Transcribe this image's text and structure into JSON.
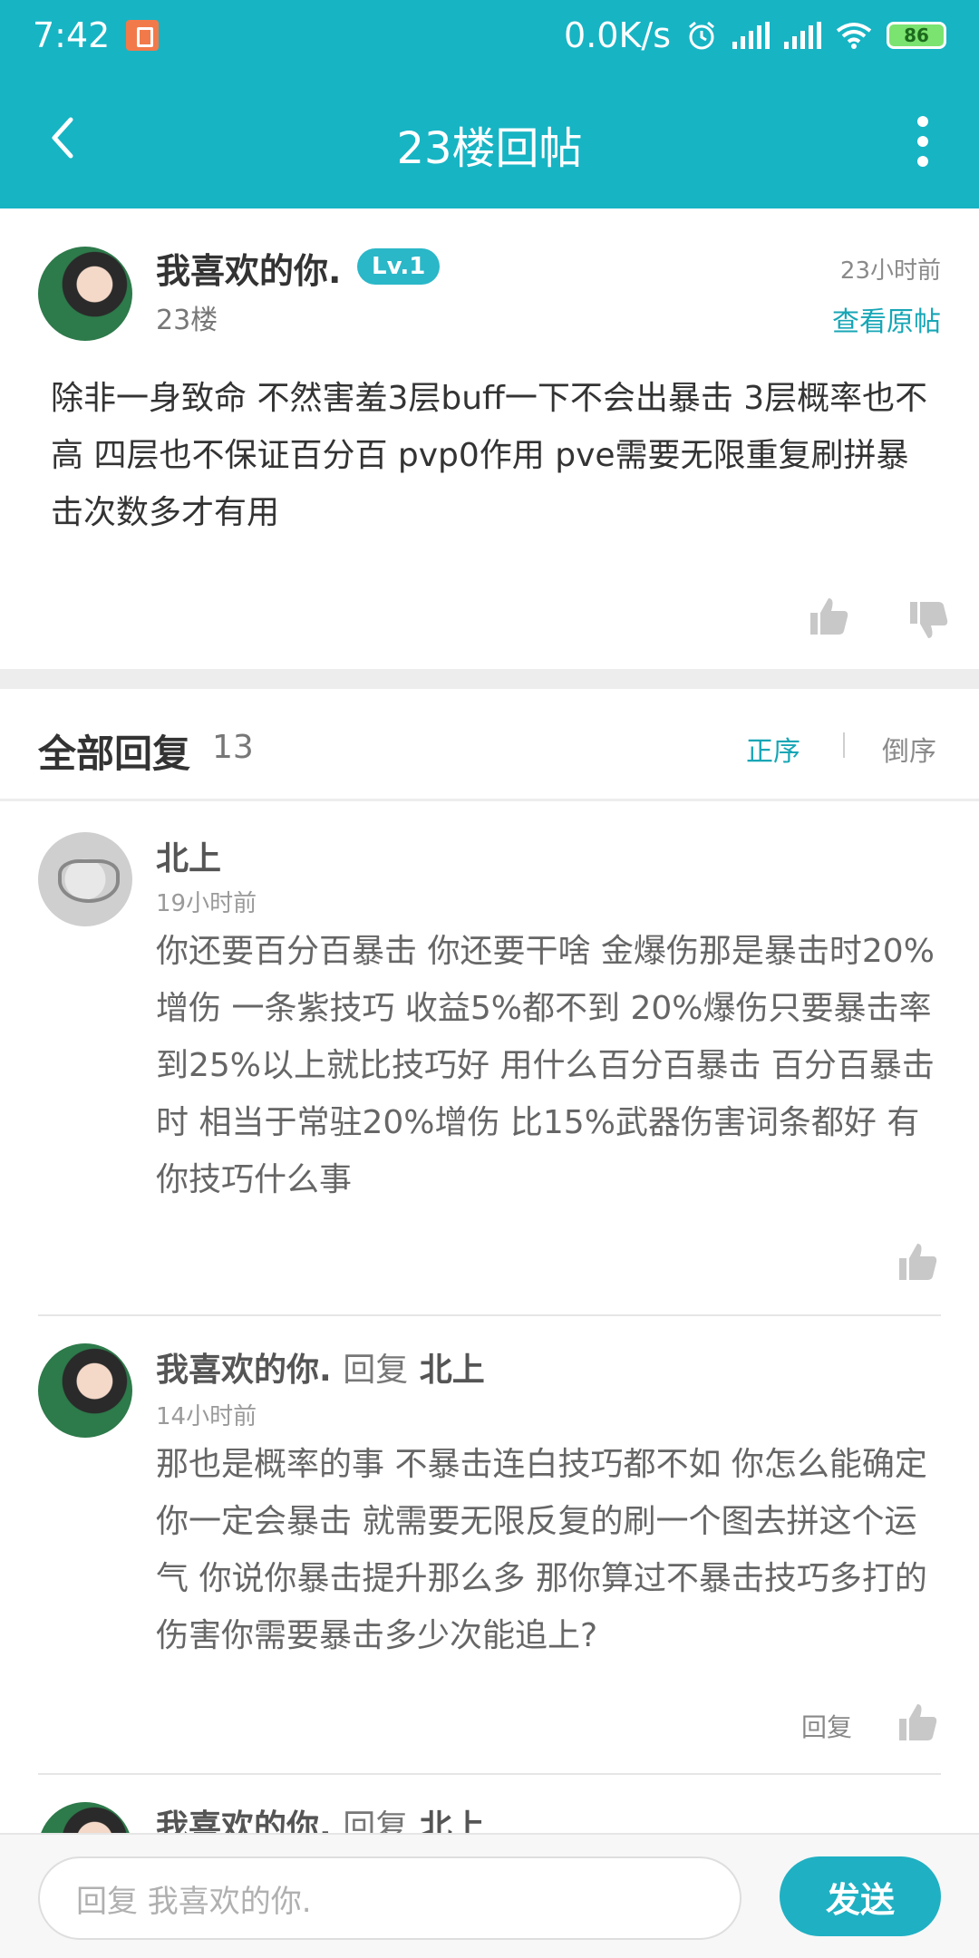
{
  "status_bar": {
    "time": "7:42",
    "network_speed": "0.0K/s",
    "battery": "86"
  },
  "nav": {
    "title": "23楼回帖"
  },
  "post": {
    "username": "我喜欢的你.",
    "level": "Lv.1",
    "floor": "23楼",
    "time": "23小时前",
    "view_original": "查看原帖",
    "content": "除非一身致命 不然害羞3层buff一下不会出暴击 3层概率也不高 四层也不保证百分百 pvp0作用 pve需要无限重复刷拼暴击次数多才有用"
  },
  "replies_header": {
    "title": "全部回复",
    "count": "13",
    "sort_asc": "正序",
    "sort_desc": "倒序"
  },
  "replies": [
    {
      "username": "北上",
      "time": "19小时前",
      "content": "你还要百分百暴击   你还要干啥   金爆伤那是暴击时20%增伤   一条紫技巧  收益5%都不到   20%爆伤只要暴击率到25%以上就比技巧好   用什么百分百暴击  百分百暴击时   相当于常驻20%增伤   比15%武器伤害词条都好   有你技巧什么事"
    },
    {
      "username": "我喜欢的你.",
      "reply_word": "回复",
      "reply_to": "北上",
      "time": "14小时前",
      "content": "那也是概率的事 不暴击连白技巧都不如 你怎么能确定你一定会暴击 就需要无限反复的刷一个图去拼这个运气 你说你暴击提升那么多 那你算过不暴击技巧多打的伤害你需要暴击多少次能追上?",
      "reply_button": "回复"
    },
    {
      "username": "我喜欢的你.",
      "reply_word": "回复",
      "reply_to": "北上"
    }
  ],
  "input_bar": {
    "placeholder": "回复 我喜欢的你.",
    "send_label": "发送"
  },
  "colors": {
    "header": "#17b4c4",
    "accent": "#17a6b6",
    "send_button": "#1fb0c3"
  }
}
